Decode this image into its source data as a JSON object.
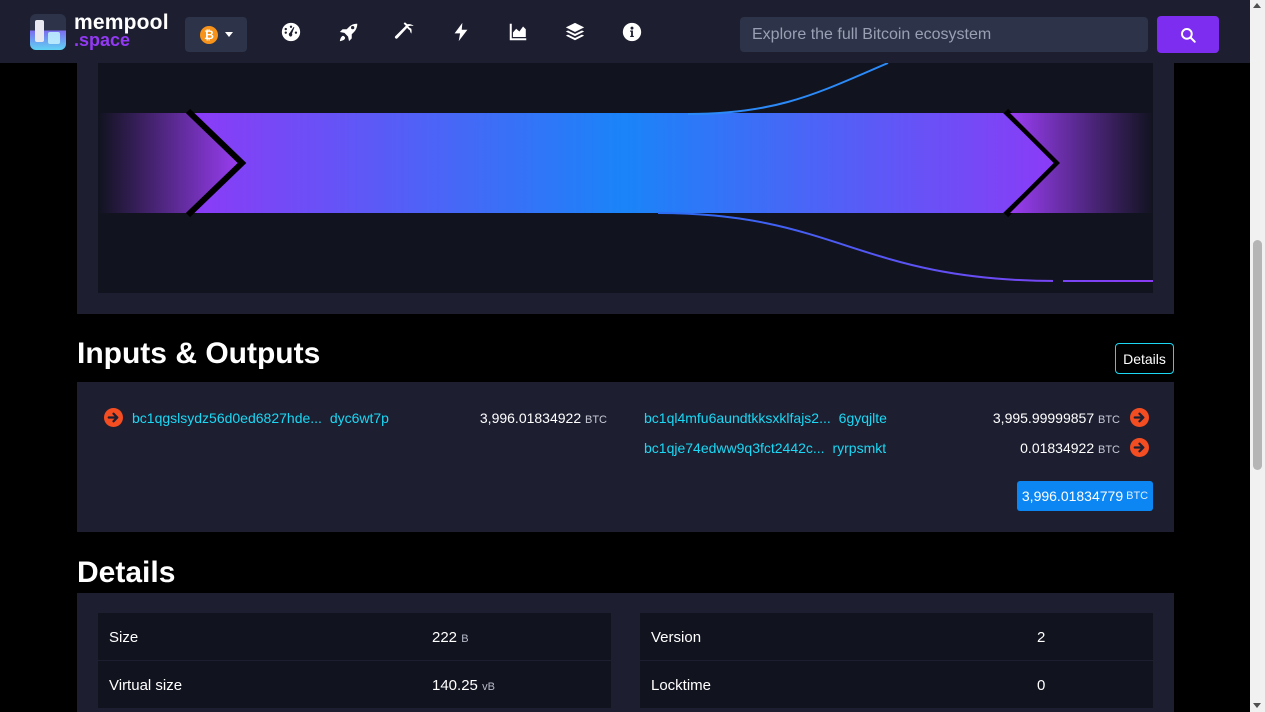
{
  "brand": {
    "name": "mempool",
    "sub": ".space"
  },
  "network": {
    "coin_symbol": "₿"
  },
  "nav": [
    "dashboard-icon",
    "rocket-icon",
    "mining-icon",
    "lightning-icon",
    "graphs-icon",
    "blocks-icon",
    "about-icon"
  ],
  "search": {
    "placeholder": "Explore the full Bitcoin ecosystem",
    "button_icon": "search-icon"
  },
  "inputs_outputs": {
    "title": "Inputs & Outputs",
    "details_label": "Details",
    "inputs": [
      {
        "address_start": "bc1qgslsydz56d0ed6827hde...",
        "address_end": "dyc6wt7p",
        "amount": "3,996.01834922",
        "unit": "BTC"
      }
    ],
    "outputs": [
      {
        "address_start": "bc1ql4mfu6aundtkksxklfajs2...",
        "address_end": "6gyqjlte",
        "amount": "3,995.99999857",
        "unit": "BTC"
      },
      {
        "address_start": "bc1qje74edww9q3fct2442c...",
        "address_end": "ryrpsmkt",
        "amount": "0.01834922",
        "unit": "BTC"
      }
    ],
    "total": {
      "amount": "3,996.01834779",
      "unit": "BTC"
    }
  },
  "details": {
    "title": "Details",
    "rows": [
      {
        "label": "Size",
        "value": "222",
        "unit": "B"
      },
      {
        "label": "Version",
        "value": "2",
        "unit": ""
      },
      {
        "label": "Virtual size",
        "value": "140.25",
        "unit": "vB"
      },
      {
        "label": "Locktime",
        "value": "0",
        "unit": ""
      }
    ]
  },
  "colors": {
    "accent": "#9339f4",
    "link": "#1bd8f4",
    "arrow": "#f44d22",
    "badge": "#0b86f3",
    "panel": "#1d1f31",
    "nav": "#1d1f31"
  }
}
